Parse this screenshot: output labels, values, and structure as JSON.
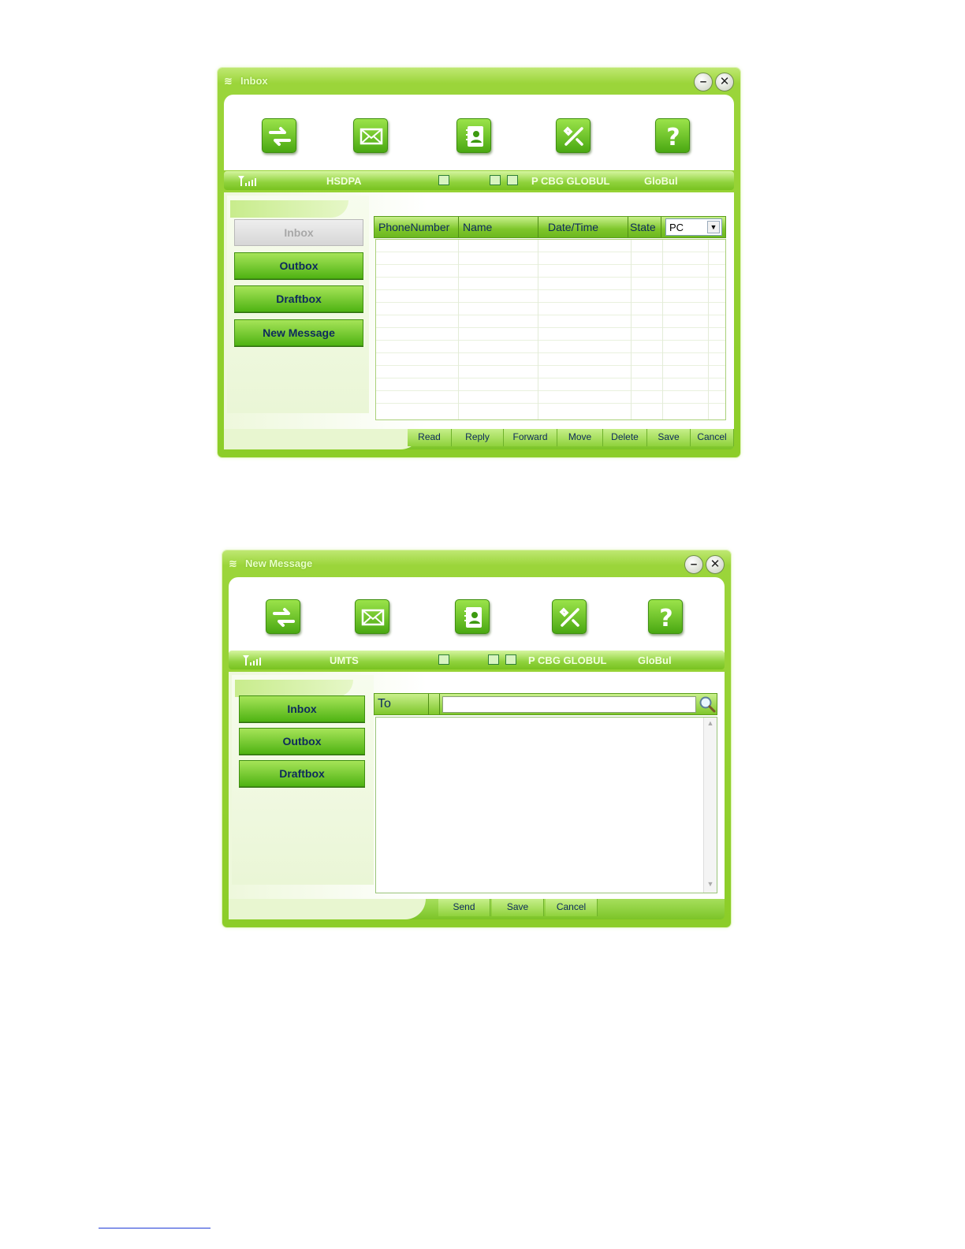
{
  "inbox_window": {
    "title": "Inbox",
    "minimize": "–",
    "close": "✕",
    "toolbar": [
      "transfer-icon",
      "envelope-icon",
      "contacts-icon",
      "tools-icon",
      "help-icon"
    ],
    "help_glyph": "?",
    "status": {
      "network": "HSDPA",
      "operator": "P CBG GLOBUL",
      "provider": "GloBul"
    },
    "nav": [
      {
        "label": "Inbox",
        "active": true
      },
      {
        "label": "Outbox"
      },
      {
        "label": "Draftbox"
      },
      {
        "label": "New Message"
      }
    ],
    "columns": [
      "PhoneNumber",
      "Name",
      "Date/Time",
      "State"
    ],
    "storage_select": "PC",
    "actions": [
      "Read",
      "Reply",
      "Forward",
      "Move",
      "Delete",
      "Save",
      "Cancel"
    ]
  },
  "new_message_window": {
    "title": "New Message",
    "minimize": "–",
    "close": "✕",
    "help_glyph": "?",
    "status": {
      "network": "UMTS",
      "operator": "P CBG GLOBUL",
      "provider": "GloBul"
    },
    "nav": [
      {
        "label": "Inbox"
      },
      {
        "label": "Outbox"
      },
      {
        "label": "Draftbox"
      }
    ],
    "to_label": "To",
    "to_value": "",
    "message_body": "",
    "actions": [
      "Send",
      "Save",
      "Cancel"
    ]
  },
  "colors": {
    "accent": "#8ccd28",
    "text_dark": "#0d2a5c",
    "header_text": "#e8ffc8"
  }
}
